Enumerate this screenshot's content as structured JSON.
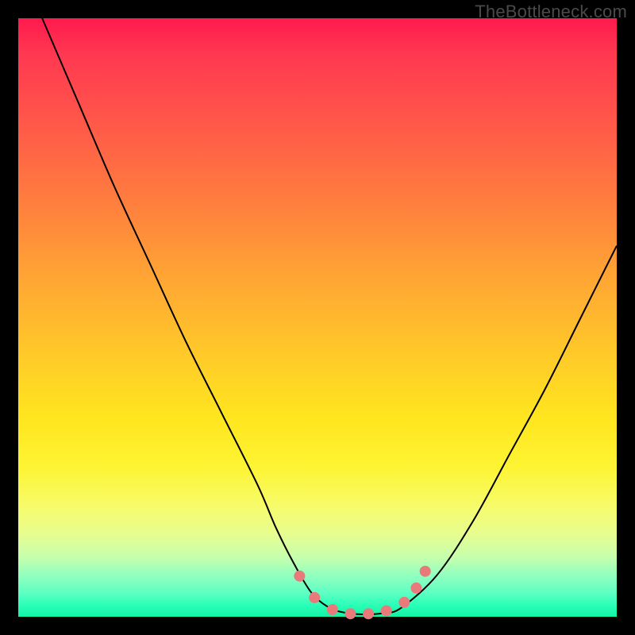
{
  "watermark": "TheBottleneck.com",
  "colors": {
    "frame": "#000000",
    "curve": "#000000",
    "marker": "#e97a7c"
  },
  "chart_data": {
    "type": "line",
    "title": "",
    "xlabel": "",
    "ylabel": "",
    "xlim": [
      0,
      100
    ],
    "ylim": [
      0,
      100
    ],
    "grid": false,
    "legend": false,
    "annotations": [
      "TheBottleneck.com"
    ],
    "series": [
      {
        "name": "bottleneck-curve",
        "x": [
          4,
          10,
          16,
          22,
          28,
          34,
          40,
          43,
          46,
          49,
          52,
          55,
          58,
          61,
          64,
          70,
          76,
          82,
          88,
          94,
          100
        ],
        "y": [
          100,
          86,
          72,
          59,
          46,
          34,
          22,
          15,
          9,
          4,
          1.5,
          0.6,
          0.4,
          0.6,
          1.5,
          7,
          16,
          27,
          38,
          50,
          62
        ]
      }
    ],
    "markers": {
      "name": "trough-markers",
      "x": [
        47.0,
        49.5,
        52.5,
        55.5,
        58.5,
        61.5,
        64.5,
        66.5,
        68.0
      ],
      "y": [
        6.8,
        3.2,
        1.2,
        0.5,
        0.5,
        1.0,
        2.4,
        4.8,
        7.6
      ]
    }
  }
}
